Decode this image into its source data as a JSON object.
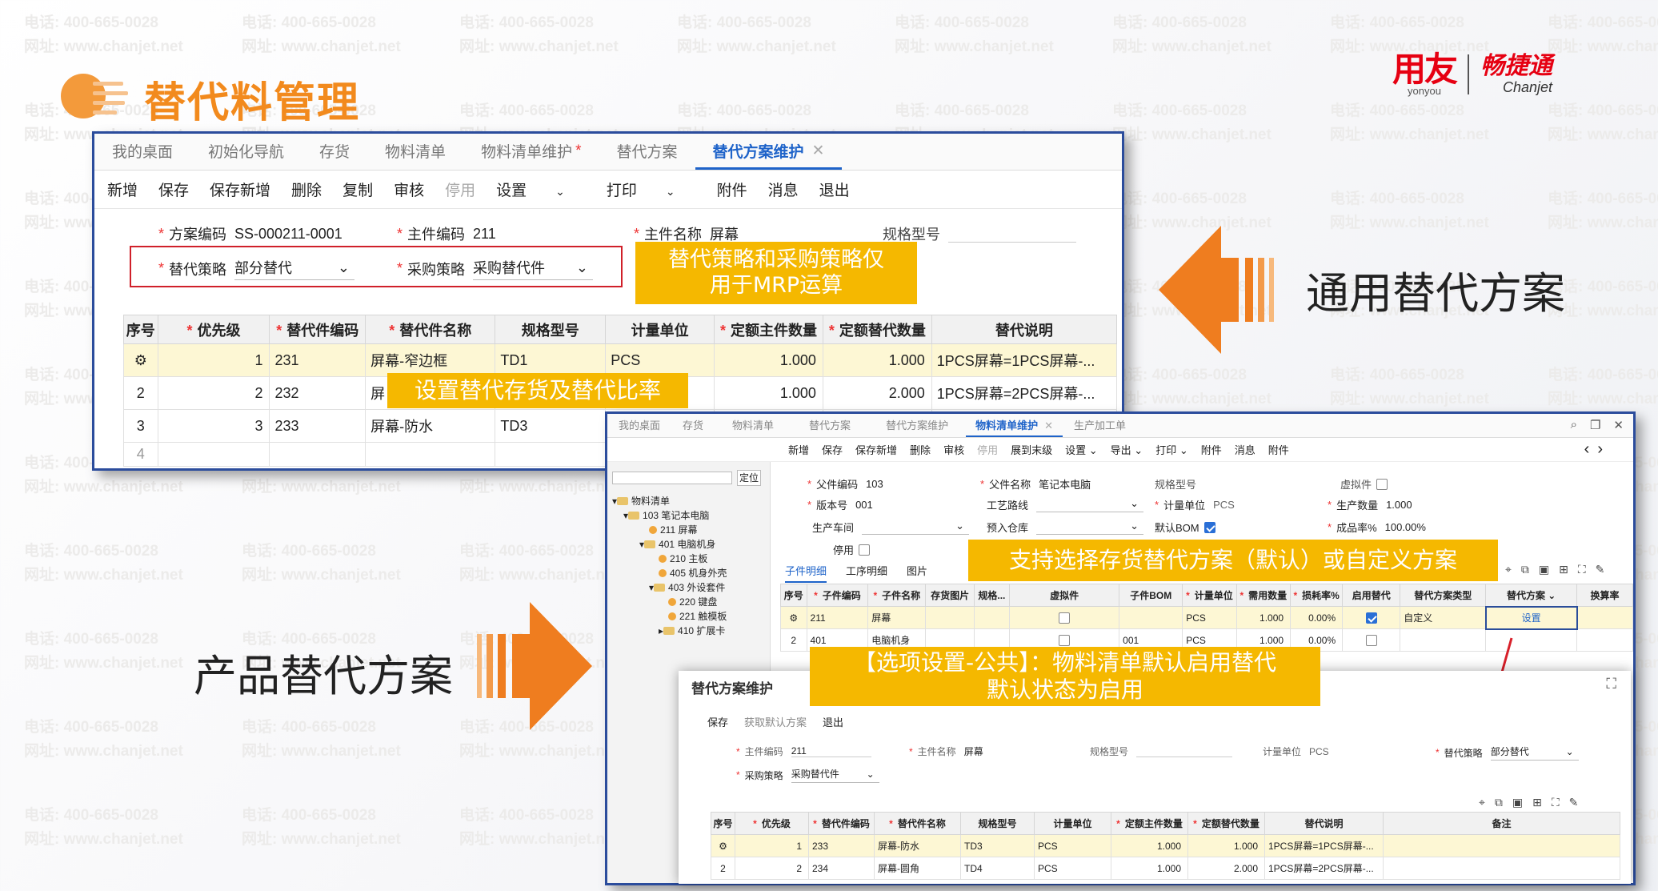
{
  "watermark": {
    "phone": "电话: 400-665-0028",
    "site": "网址: www.chanjet.net"
  },
  "slide": {
    "title": "替代料管理",
    "general_label": "通用替代方案",
    "product_label": "产品替代方案"
  },
  "logo": {
    "yonyou_cn": "用友",
    "yonyou_en": "yonyou",
    "chanjet_cn": "畅捷通",
    "chanjet_en": "Chanjet"
  },
  "win1": {
    "tabs": [
      {
        "label": "我的桌面"
      },
      {
        "label": "初始化导航"
      },
      {
        "label": "存货"
      },
      {
        "label": "物料清单"
      },
      {
        "label": "物料清单维护",
        "star": "*"
      },
      {
        "label": "替代方案"
      },
      {
        "label": "替代方案维护",
        "close": "✕"
      }
    ],
    "toolbar": [
      "新增",
      "保存",
      "保存新增",
      "删除",
      "复制",
      "审核",
      "停用",
      "设置",
      "打印",
      "附件",
      "消息",
      "退出"
    ],
    "form": {
      "scheme_code_label": "方案编码",
      "scheme_code": "SS-000211-0001",
      "main_code_label": "主件编码",
      "main_code": "211",
      "main_name_label": "主件名称",
      "main_name": "屏幕",
      "spec_label": "规格型号",
      "strategy_label": "替代策略",
      "strategy": "部分替代",
      "purchase_label": "采购策略",
      "purchase": "采购替代件"
    },
    "columns": [
      "序号",
      "优先级",
      "替代件编码",
      "替代件名称",
      "规格型号",
      "计量单位",
      "定额主件数量",
      "定额替代数量",
      "替代说明"
    ],
    "rows": [
      {
        "seq": "",
        "priority": "1",
        "code": "231",
        "name": "屏幕-窄边框",
        "spec": "TD1",
        "unit": "PCS",
        "main_qty": "1.000",
        "sub_qty": "1.000",
        "desc": "1PCS屏幕=1PCS屏幕-..."
      },
      {
        "seq": "2",
        "priority": "2",
        "code": "232",
        "name": "屏",
        "spec": "",
        "unit": "",
        "main_qty": "1.000",
        "sub_qty": "2.000",
        "desc": "1PCS屏幕=2PCS屏幕-..."
      },
      {
        "seq": "3",
        "priority": "3",
        "code": "233",
        "name": "屏幕-防水",
        "spec": "TD3",
        "unit": "",
        "main_qty": "",
        "sub_qty": "",
        "desc": ""
      }
    ],
    "row4_seq": "4"
  },
  "callouts": {
    "c1_line1": "替代策略和采购策略仅",
    "c1_line2": "用于MRP运算",
    "c2": "设置替代存货及替代比率",
    "c3": "支持选择存货替代方案（默认）或自定义方案",
    "c4_line1": "【选项设置-公共】：物料清单默认启用替代",
    "c4_line2": "默认状态为启用"
  },
  "win2": {
    "tabs": [
      {
        "label": "我的桌面"
      },
      {
        "label": "存货"
      },
      {
        "label": "物料清单"
      },
      {
        "label": "替代方案"
      },
      {
        "label": "替代方案维护"
      },
      {
        "label": "物料清单维护",
        "close": "✕"
      },
      {
        "label": "生产加工单"
      }
    ],
    "toolbar": [
      "新增",
      "保存",
      "保存新增",
      "删除",
      "审核",
      "停用",
      "展到末级",
      "设置",
      "导出",
      "打印",
      "附件",
      "消息",
      "附件"
    ],
    "locate_btn": "定位",
    "tree": [
      "物料清单",
      "103 笔记本电脑",
      "211 屏幕",
      "401 电脑机身",
      "210 主板",
      "405 机身外壳",
      "403 外设套件",
      "220 键盘",
      "221 触模板",
      "410 扩展卡"
    ],
    "form": {
      "parent_code_label": "父件编码",
      "parent_code": "103",
      "parent_name_label": "父件名称",
      "parent_name": "笔记本电脑",
      "spec_label": "规格型号",
      "virtual_label": "虚拟件",
      "version_label": "版本号",
      "version": "001",
      "route_label": "工艺路线",
      "unit_label": "计量单位",
      "unit": "PCS",
      "prod_qty_label": "生产数量",
      "prod_qty": "1.000",
      "workshop_label": "生产车间",
      "warehouse_label": "预入仓库",
      "default_bom_label": "默认BOM",
      "yield_label": "成品率%",
      "yield": "100.00%",
      "disabled_label": "停用"
    },
    "subtabs": [
      "子件明细",
      "工序明细",
      "图片"
    ],
    "columns": [
      "序号",
      "子件编码",
      "子件名称",
      "存货图片",
      "规格...",
      "虚拟件",
      "子件BOM",
      "计量单位",
      "需用数量",
      "损耗率%",
      "启用替代",
      "替代方案类型",
      "替代方案",
      "换算率"
    ],
    "rows": [
      {
        "seq": "",
        "code": "211",
        "name": "屏幕",
        "bom": "",
        "unit": "PCS",
        "qty": "1.000",
        "loss": "0.00%",
        "enable": true,
        "type": "自定义",
        "scheme": "设置"
      },
      {
        "seq": "2",
        "code": "401",
        "name": "电脑机身",
        "bom": "001",
        "unit": "PCS",
        "qty": "1.000",
        "loss": "0.00%",
        "enable": false,
        "type": "",
        "scheme": ""
      }
    ]
  },
  "win3": {
    "title": "替代方案维护",
    "toolbar": [
      "保存",
      "获取默认方案",
      "退出"
    ],
    "form": {
      "main_code_label": "主件编码",
      "main_code": "211",
      "main_name_label": "主件名称",
      "main_name": "屏幕",
      "spec_label": "规格型号",
      "unit_label": "计量单位",
      "unit": "PCS",
      "strategy_label": "替代策略",
      "strategy": "部分替代",
      "purchase_label": "采购策略",
      "purchase": "采购替代件"
    },
    "columns": [
      "序号",
      "优先级",
      "替代件编码",
      "替代件名称",
      "规格型号",
      "计量单位",
      "定额主件数量",
      "定额替代数量",
      "替代说明",
      "备注"
    ],
    "rows": [
      {
        "seq": "",
        "priority": "1",
        "code": "233",
        "name": "屏幕-防水",
        "spec": "TD3",
        "unit": "PCS",
        "main_qty": "1.000",
        "sub_qty": "1.000",
        "desc": "1PCS屏幕=1PCS屏幕-..."
      },
      {
        "seq": "2",
        "priority": "2",
        "code": "234",
        "name": "屏幕-圆角",
        "spec": "TD4",
        "unit": "PCS",
        "main_qty": "1.000",
        "sub_qty": "2.000",
        "desc": "1PCS屏幕=2PCS屏幕-..."
      }
    ]
  },
  "colors": {
    "accent_orange": "#f28a1d",
    "callout_yellow": "#f5b800",
    "window_border": "#2b4c9c",
    "active_tab": "#1e63c9",
    "logo_red": "#e60012"
  },
  "icons": [
    "gear-icon",
    "chevron-down-icon",
    "close-icon",
    "search-icon",
    "restore-icon",
    "arrow-left-icon",
    "arrow-right-icon",
    "expand-icon",
    "folder-icon"
  ]
}
